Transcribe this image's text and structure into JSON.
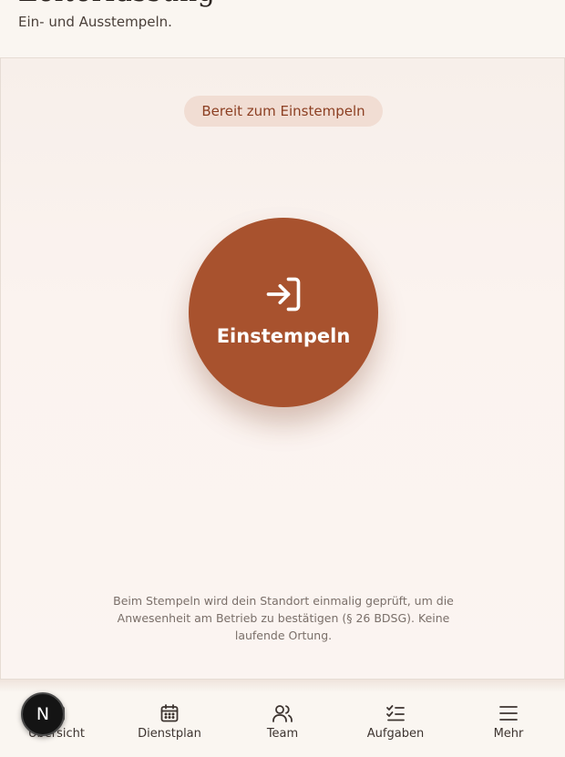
{
  "header": {
    "title": "Zeiterfassung",
    "subtitle": "Ein- und Ausstempeln."
  },
  "clock": {
    "status": "Bereit zum Einstempeln",
    "button_label": "Einstempeln",
    "button_icon": "log-in-icon",
    "accent_color": "#a8522e",
    "privacy_notice": "Beim Stempeln wird dein Standort einmalig geprüft, um die Anwesenheit am Betrieb zu bestätigen (§ 26 BDSG). Keine laufende Ortung."
  },
  "nav": {
    "items": [
      {
        "label": "Übersicht",
        "icon": "home-icon"
      },
      {
        "label": "Dienstplan",
        "icon": "calendar-icon"
      },
      {
        "label": "Team",
        "icon": "users-icon"
      },
      {
        "label": "Aufgaben",
        "icon": "checklist-icon"
      },
      {
        "label": "Mehr",
        "icon": "menu-icon"
      }
    ]
  },
  "avatar": {
    "initial": "N"
  }
}
